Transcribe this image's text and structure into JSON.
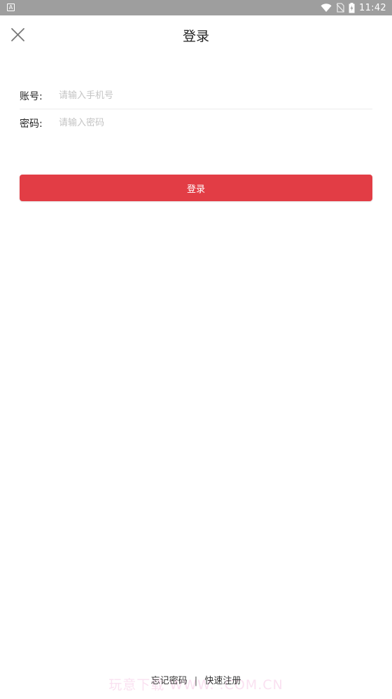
{
  "status_bar": {
    "left_icon": "A",
    "time": "11:42",
    "icons": [
      "wifi-icon",
      "no-sim-icon",
      "battery-charging-icon"
    ]
  },
  "header": {
    "title": "登录",
    "close_icon": "close-icon"
  },
  "form": {
    "account_label": "账号:",
    "account_placeholder": "请输入手机号",
    "account_value": "",
    "password_label": "密码:",
    "password_placeholder": "请输入密码",
    "password_value": ""
  },
  "login_button": "登录",
  "footer": {
    "forgot_password": "忘记密码",
    "separator": "|",
    "quick_register": "快速注册"
  },
  "watermark": "玩意下载 WWW.            .COM.CN",
  "colors": {
    "status_bar_bg": "#9e9e9e",
    "accent": "#e23d45",
    "placeholder": "#c4c4c4",
    "divider": "#ececec"
  }
}
